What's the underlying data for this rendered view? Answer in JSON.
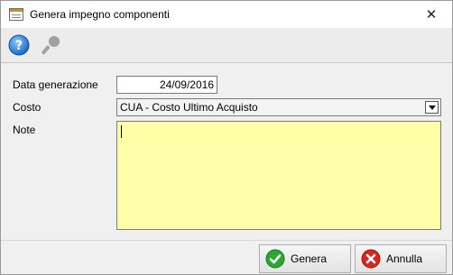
{
  "window": {
    "title": "Genera impegno componenti",
    "close_symbol": "✕",
    "icon": "app-window-icon"
  },
  "toolbar": {
    "help_icon": "help-icon",
    "search_icon": "key-icon"
  },
  "form": {
    "date_label": "Data generazione",
    "date_value": "24/09/2016",
    "cost_label": "Costo",
    "cost_value": "CUA - Costo Ultimo Acquisto",
    "notes_label": "Note",
    "notes_value": "",
    "notes_bg": "#ffffa8"
  },
  "footer": {
    "genera_label": "Genera",
    "annulla_label": "Annulla",
    "ok_color": "#2aa832",
    "cancel_color": "#d9261c"
  }
}
